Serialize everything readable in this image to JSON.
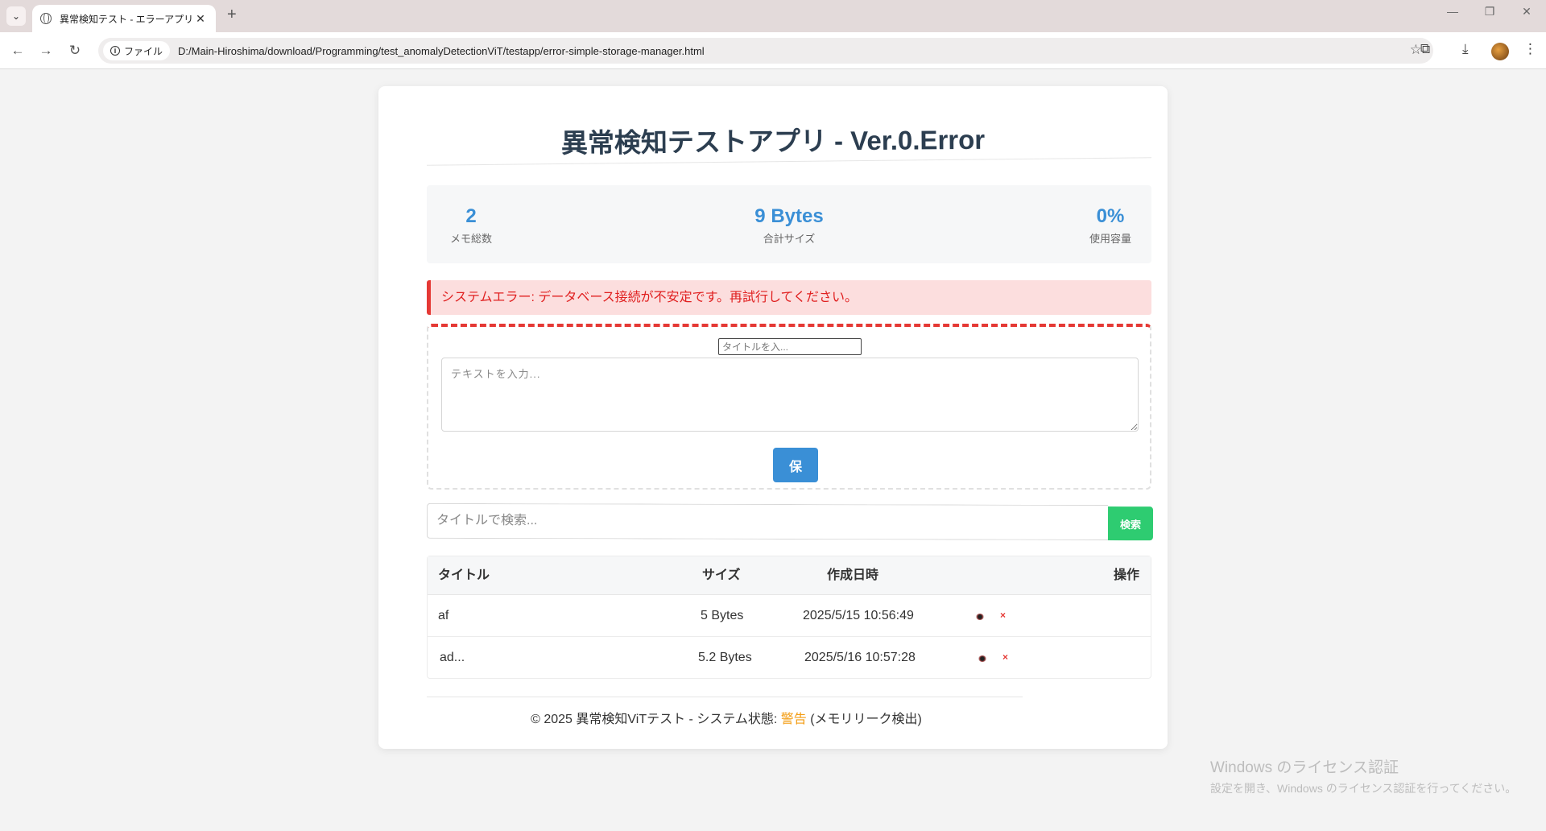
{
  "browser": {
    "tab_title": "異常検知テスト - エラーアプリ",
    "tab_close": "✕",
    "new_tab": "+",
    "chip_label": "ファイル",
    "url": "D:/Main-Hiroshima/download/Programming/test_anomalyDetectionViT/testapp/error-simple-storage-manager.html",
    "icons": [
      "tab-menu-icon",
      "globe-icon",
      "back-icon",
      "forward-icon",
      "reload-icon",
      "info-icon",
      "star-icon",
      "extensions-icon",
      "download-icon",
      "profile-avatar",
      "more-icon",
      "minimize-icon",
      "restore-icon",
      "close-window-icon"
    ]
  },
  "page": {
    "title": "異常検知テストアプリ - Ver.0.Error"
  },
  "stats": {
    "memo_count_value": "2",
    "memo_count_label": "メモ総数",
    "total_size_value": "9 Bytes",
    "total_size_label": "合計サイズ",
    "usage_value": "0%",
    "usage_label": "使用容量"
  },
  "alert": {
    "message": "システムエラー: データベース接続が不安定です。再試行してください。",
    "color": "#e53935"
  },
  "form": {
    "title_placeholder": "タイトルを入...",
    "text_placeholder": "テキストを入力...",
    "save_label": "保"
  },
  "search": {
    "placeholder": "タイトルで検索...",
    "button_label": "検索",
    "button_color": "#2ecc71"
  },
  "table": {
    "headers": {
      "title": "タイトル",
      "size": "サイズ",
      "created": "作成日時",
      "actions": "操作"
    },
    "rows": [
      {
        "title": "af",
        "size": "5 Bytes",
        "created": "2025/5/15 10:56:49",
        "view_icon": "eye-icon",
        "delete_icon": "×"
      },
      {
        "title": "ad...",
        "size": "5.2 Bytes",
        "created": "2025/5/16 10:57:28",
        "view_icon": "eye-icon",
        "delete_icon": "×"
      }
    ]
  },
  "footer": {
    "prefix": "© 2025 異常検知ViTテスト - システム状態: ",
    "status": "警告",
    "suffix": " (メモリリーク検出)",
    "status_color": "#f39c12"
  },
  "watermark": {
    "line1": "Windows のライセンス認証",
    "line2": "設定を開き、Windows のライセンス認証を行ってください。"
  },
  "colors": {
    "accent": "#3a8fd6",
    "title": "#2c3e50"
  }
}
